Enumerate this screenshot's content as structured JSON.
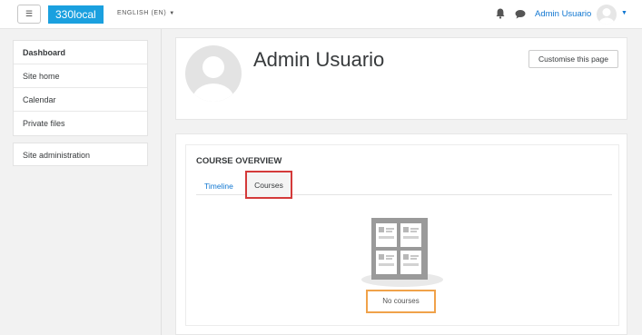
{
  "navbar": {
    "menu_icon": "hamburger-icon",
    "brand": "330local",
    "language": "ENGLISH (EN)",
    "user_name": "Admin Usuario",
    "brand_color": "#1aa0df",
    "link_color": "#1177d1"
  },
  "sidebar": {
    "items": [
      {
        "label": "Dashboard"
      },
      {
        "label": "Site home"
      },
      {
        "label": "Calendar"
      },
      {
        "label": "Private files"
      }
    ],
    "admin": "Site administration"
  },
  "header": {
    "title": "Admin Usuario",
    "customise_label": "Customise this page"
  },
  "overview": {
    "title": "COURSE OVERVIEW",
    "tabs": [
      {
        "label": "Timeline"
      },
      {
        "label": "Courses"
      }
    ],
    "empty_text": "No courses"
  }
}
